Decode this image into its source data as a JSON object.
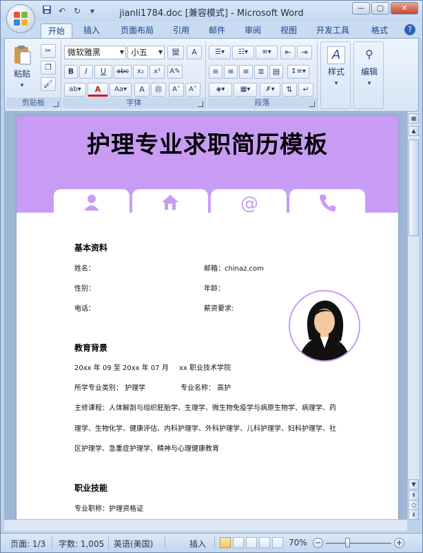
{
  "window": {
    "title": "jianli1784.doc [兼容模式] - Microsoft Word"
  },
  "qat": {
    "save": "save-icon",
    "undo": "↶",
    "redo": "↻",
    "customize": "▾"
  },
  "tabs": [
    "开始",
    "插入",
    "页面布局",
    "引用",
    "邮件",
    "审阅",
    "视图",
    "开发工具",
    "格式"
  ],
  "ribbon": {
    "clipboard": {
      "label": "剪贴板",
      "paste": "粘贴"
    },
    "font": {
      "label": "字体",
      "font_name": "微软雅黑",
      "font_size": "小五"
    },
    "paragraph": {
      "label": "段落"
    },
    "styles": {
      "label": "样式"
    },
    "editing": {
      "label": "编辑"
    }
  },
  "document": {
    "title": "护理专业求职简历模板",
    "basic": {
      "heading": "基本资料",
      "name": "姓名：",
      "email": "邮箱：chinaz.com",
      "gender": "性别：",
      "age": "年龄：",
      "phone": "电话：",
      "salary": "薪资要求:"
    },
    "education": {
      "heading": "教育背景",
      "period": "20xx 年 09 至 20xx 年 07 月",
      "school": "xx 职业技术学院",
      "category": "所学专业类别：  护理学",
      "major": "专业名称：    高护",
      "courses_1": "主修课程：人体解剖与组织胚胎学、生理学、微生物免疫学与病原生物学、病理学、药",
      "courses_2": "理学、生物化学、健康评估、内科护理学、外科护理学、儿科护理学、妇科护理学、社",
      "courses_3": "区护理学、急重症护理学、精神与心理健康教育"
    },
    "skills": {
      "heading": "职业技能",
      "title": "专业职称：护理资格证"
    }
  },
  "status": {
    "page": "页面: 1/3",
    "words": "字数: 1,005",
    "language": "英语(美国)",
    "insert": "插入",
    "zoom": "70%"
  },
  "colors": {
    "accent": "#c89cf5",
    "ribbon_text": "#15428b"
  }
}
